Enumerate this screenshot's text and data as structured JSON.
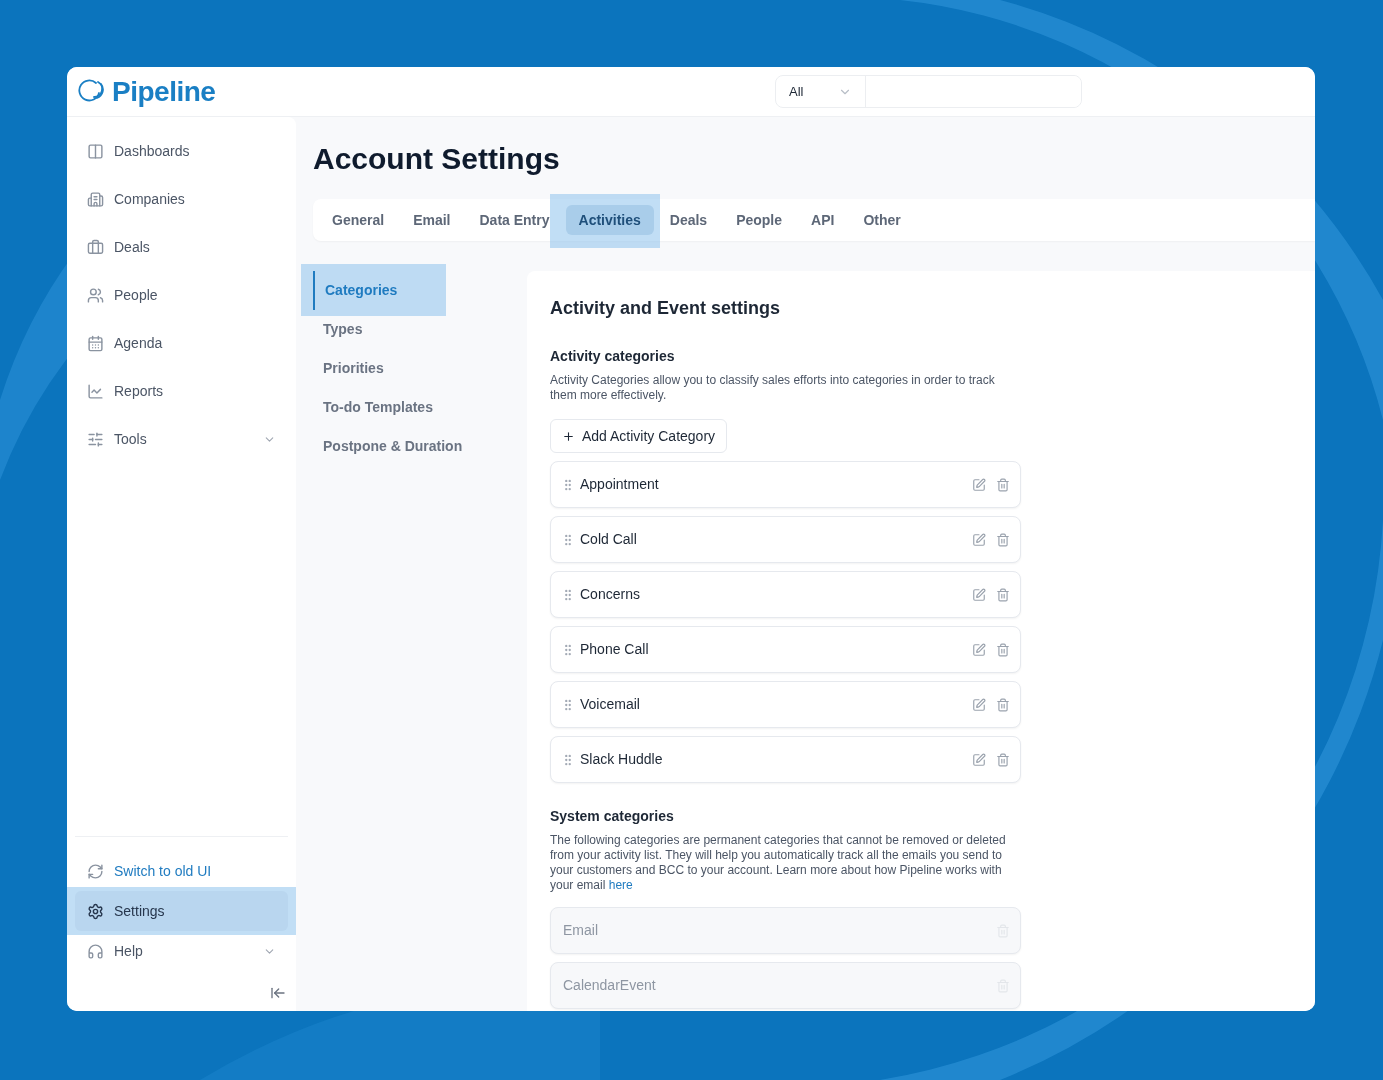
{
  "logo": {
    "text": "Pipeline"
  },
  "search": {
    "scope": "All"
  },
  "sidebar": {
    "items": [
      {
        "label": "Dashboards",
        "kind": "link",
        "selected": false
      },
      {
        "label": "Companies",
        "kind": "link",
        "selected": false
      },
      {
        "label": "Deals",
        "kind": "link",
        "selected": false
      },
      {
        "label": "People",
        "kind": "link",
        "selected": false
      },
      {
        "label": "Agenda",
        "kind": "link",
        "selected": false
      },
      {
        "label": "Reports",
        "kind": "link",
        "selected": false
      },
      {
        "label": "Tools",
        "kind": "group",
        "selected": false
      }
    ],
    "footer": [
      {
        "label": "Switch to old UI",
        "kind": "action",
        "selected": false
      },
      {
        "label": "Settings",
        "kind": "link",
        "selected": true
      },
      {
        "label": "Help",
        "kind": "group",
        "selected": false
      }
    ]
  },
  "page_title": "Account Settings",
  "tabs": [
    {
      "label": "General",
      "selected": false
    },
    {
      "label": "Email",
      "selected": false
    },
    {
      "label": "Data Entry",
      "selected": false
    },
    {
      "label": "Activities",
      "selected": true
    },
    {
      "label": "Deals",
      "selected": false
    },
    {
      "label": "People",
      "selected": false
    },
    {
      "label": "API",
      "selected": false
    },
    {
      "label": "Other",
      "selected": false
    }
  ],
  "subnav": [
    {
      "label": "Categories",
      "selected": true
    },
    {
      "label": "Types",
      "selected": false
    },
    {
      "label": "Priorities",
      "selected": false
    },
    {
      "label": "To-do Templates",
      "selected": false
    },
    {
      "label": "Postpone & Duration",
      "selected": false
    }
  ],
  "panel": {
    "title": "Activity and Event settings",
    "activity_categories": {
      "heading": "Activity categories",
      "description": "Activity Categories allow you to classify sales efforts into categories in order to track them more effectively.",
      "add_button": "Add Activity Category",
      "items": [
        "Appointment",
        "Cold Call",
        "Concerns",
        "Phone Call",
        "Voicemail",
        "Slack Huddle"
      ]
    },
    "system_categories": {
      "heading": "System categories",
      "description": "The following categories are permanent categories that cannot be removed or deleted from your activity list. They will help you automatically track all the emails you send to your customers and BCC to your account. Learn more about how Pipeline works with your email",
      "link": "here",
      "items": [
        "Email",
        "CalendarEvent"
      ]
    }
  }
}
